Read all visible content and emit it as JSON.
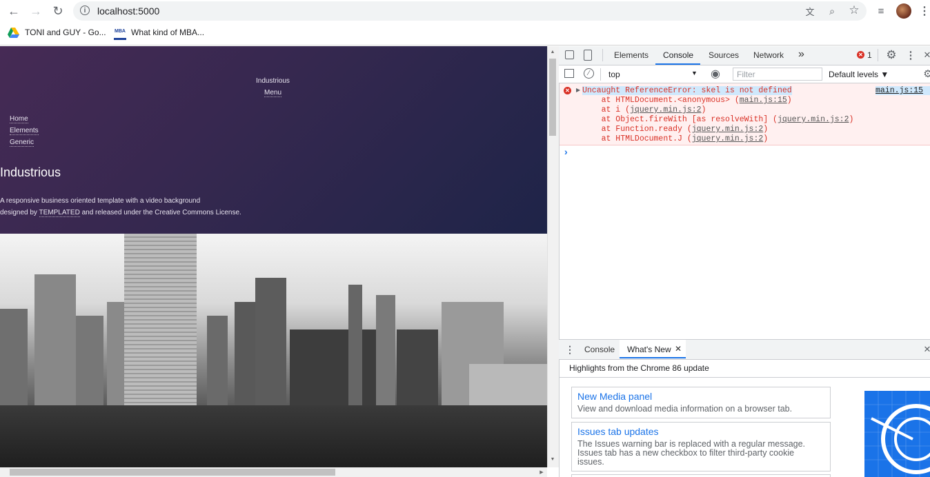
{
  "browser": {
    "url": "localhost:5000",
    "bookmarks": [
      {
        "label": "TONI and GUY - Go..."
      },
      {
        "label": "What kind of MBA..."
      }
    ]
  },
  "page": {
    "banner": {
      "logo": "Industrious",
      "menu_label": "Menu",
      "nav_items": [
        "Home",
        "Elements",
        "Generic"
      ],
      "title": "Industrious",
      "subtitle_line1": "A responsive business oriented template with a video background",
      "subtitle_line2_prefix": "designed by ",
      "subtitle_link": "TEMPLATED",
      "subtitle_line2_suffix": " and released under the Creative Commons License."
    }
  },
  "devtools": {
    "tabs": [
      "Elements",
      "Console",
      "Sources",
      "Network"
    ],
    "active_tab": "Console",
    "overflow_label": "»",
    "error_count": "1",
    "context_select": "top",
    "filter_placeholder": "Filter",
    "levels_select": "Default levels ▼",
    "error": {
      "message": "Uncaught ReferenceError: skel is not defined",
      "source": "main.js:15",
      "stack": [
        {
          "prefix": "    at HTMLDocument.<anonymous> (",
          "link": "main.js:15",
          "suffix": ")"
        },
        {
          "prefix": "    at i (",
          "link": "jquery.min.js:2",
          "suffix": ")"
        },
        {
          "prefix": "    at Object.fireWith [as resolveWith] (",
          "link": "jquery.min.js:2",
          "suffix": ")"
        },
        {
          "prefix": "    at Function.ready (",
          "link": "jquery.min.js:2",
          "suffix": ")"
        },
        {
          "prefix": "    at HTMLDocument.J (",
          "link": "jquery.min.js:2",
          "suffix": ")"
        }
      ]
    },
    "prompt": "›",
    "drawer": {
      "tabs": [
        "Console",
        "What's New"
      ],
      "active_tab": "What's New",
      "close_glyph": "✕",
      "header": "Highlights from the Chrome 86 update",
      "cards": [
        {
          "title": "New Media panel",
          "desc": "View and download media information on a browser tab."
        },
        {
          "title": "Issues tab updates",
          "desc": "The Issues warning bar is replaced with a regular message. Issues tab has a new checkbox to filter third-party cookie issues."
        }
      ]
    }
  },
  "colors": {
    "error_red": "#d93025",
    "link_blue": "#1a73e8",
    "banner_purple": "#3d2a52"
  }
}
